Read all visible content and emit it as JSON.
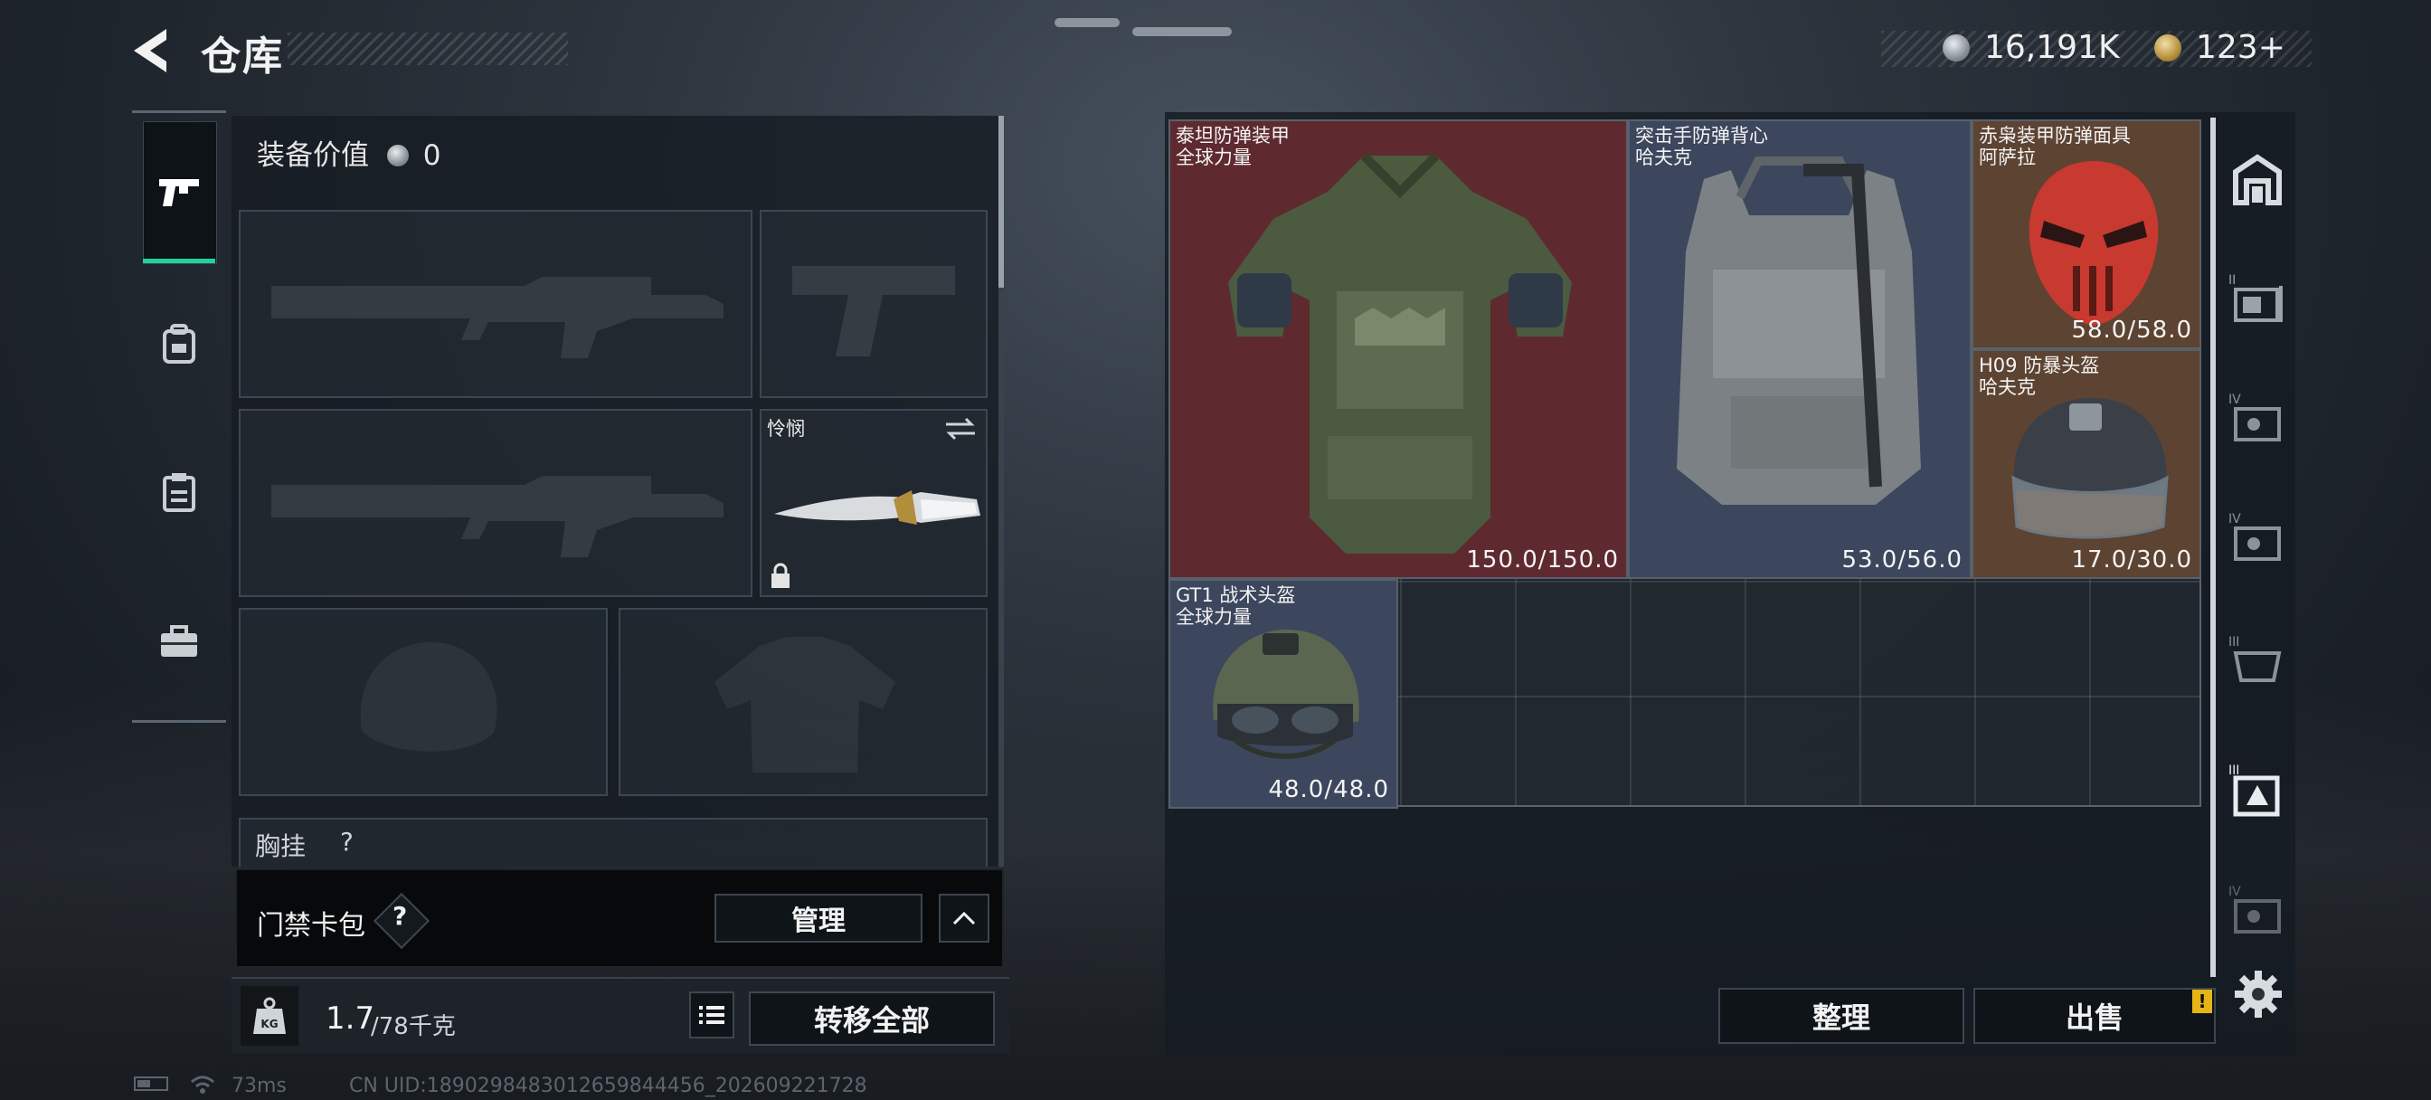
{
  "header": {
    "title": "仓库",
    "currency_silver": "16,191K",
    "currency_gold": "123+"
  },
  "loadout": {
    "equipment_value_label": "装备价值",
    "equipment_value": "0",
    "melee_name": "怜悯",
    "chest_rig_label": "胸挂",
    "chest_rig_value": "?"
  },
  "access_card": {
    "label": "门禁卡包",
    "help": "?",
    "manage_label": "管理"
  },
  "footer_left": {
    "weight_current": "1.7",
    "weight_max": "/78千克",
    "transfer_all_label": "转移全部"
  },
  "stash": {
    "items": [
      {
        "name_line1": "泰坦防弹装甲",
        "name_line2": "全球力量",
        "durability": "150.0/150.0"
      },
      {
        "name_line1": "突击手防弹背心",
        "name_line2": "哈夫克",
        "durability": "53.0/56.0"
      },
      {
        "name_line1": "赤枭装甲防弹面具",
        "name_line2": "阿萨拉",
        "durability": "58.0/58.0"
      },
      {
        "name_line1": "H09 防暴头盔",
        "name_line2": "哈夫克",
        "durability": "17.0/30.0"
      },
      {
        "name_line1": "GT1 战术头盔",
        "name_line2": "全球力量",
        "durability": "48.0/48.0"
      }
    ],
    "sort_label": "整理",
    "sell_label": "出售",
    "sell_badge": "!"
  },
  "tier_tabs": [
    "II",
    "IV",
    "IV",
    "III",
    "III",
    "IV"
  ],
  "status": {
    "ping": "73ms",
    "uid": "CN UID:1890298483012659844456_202609221728"
  },
  "colors": {
    "accent_green": "#21d39b",
    "rarity_red": "#6b2c31",
    "rarity_orange": "#6b4a33",
    "rarity_blue": "#3f4a63"
  }
}
